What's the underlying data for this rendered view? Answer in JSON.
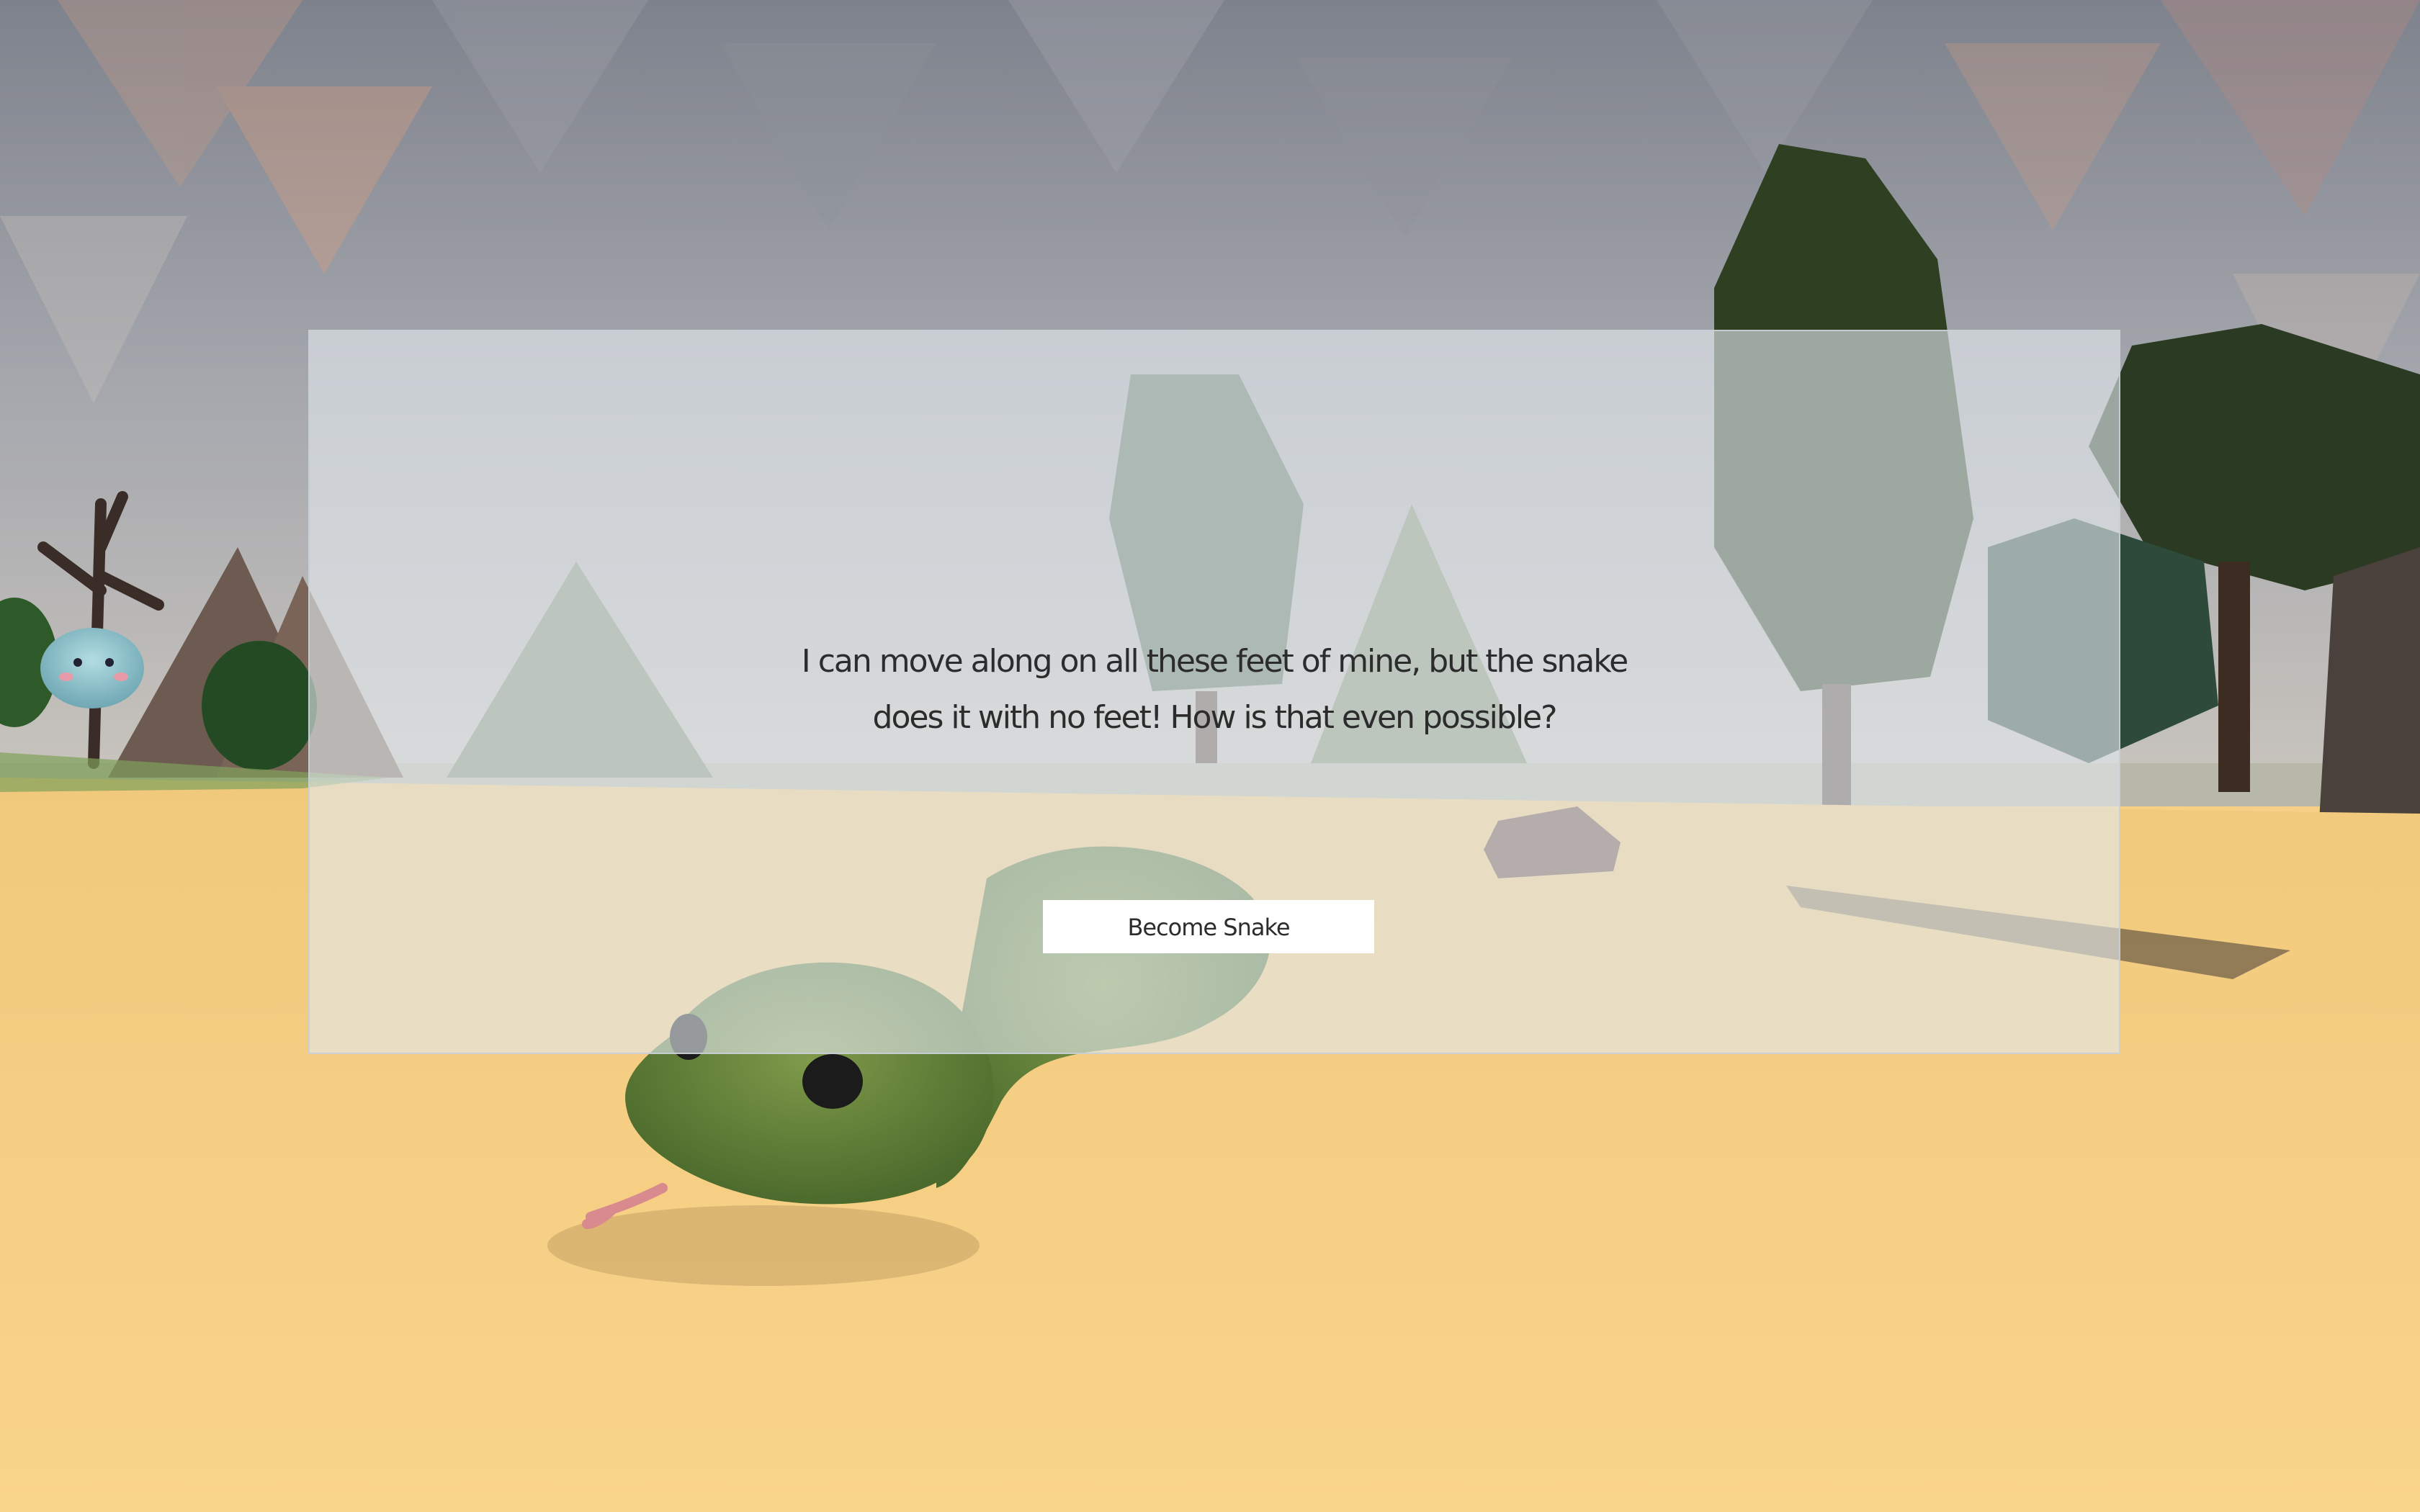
{
  "dialog": {
    "line1": "I can move along on all these feet of mine, but the snake",
    "line2": "does it with no feet! How is that even possible?",
    "button_label": "Become Snake"
  },
  "colors": {
    "ground": "#f6d085",
    "sky": "#9da3ad",
    "panel": "#e2e8ee",
    "button_bg": "#ffffff",
    "text": "#2c2c2c",
    "snake": "#5f7a3a"
  }
}
